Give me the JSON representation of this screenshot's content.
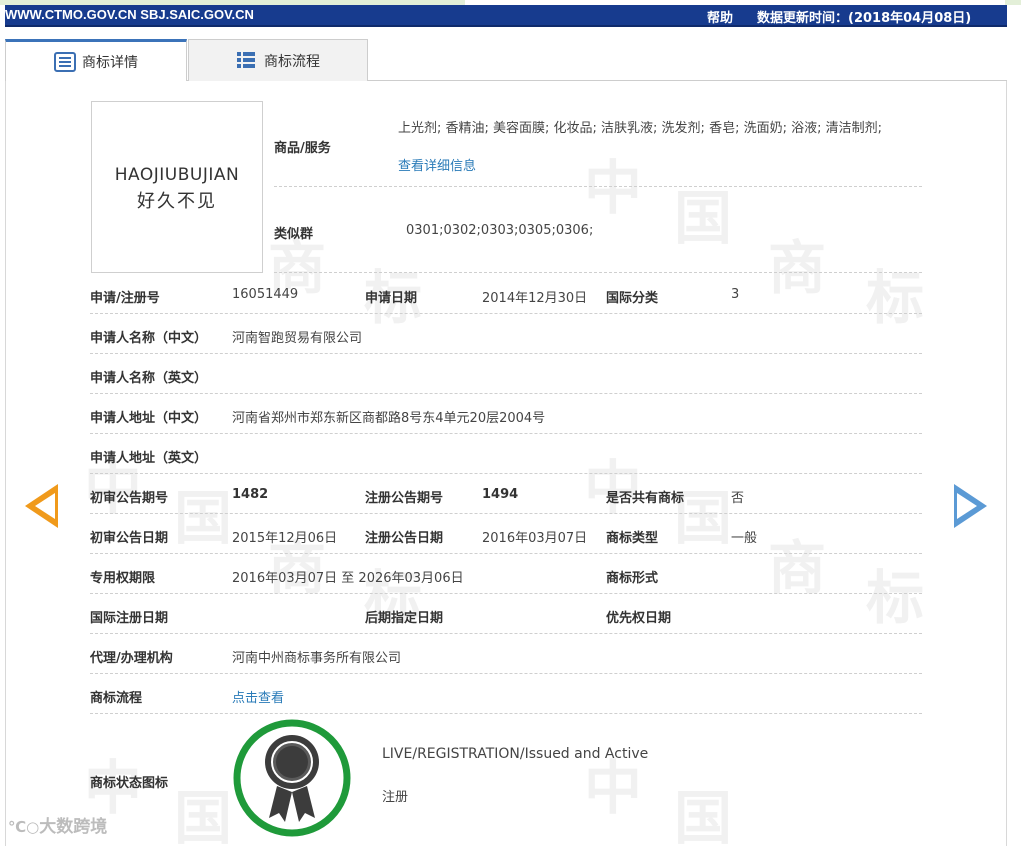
{
  "topbar": {
    "site": "WWW.CTMO.GOV.CN SBJ.SAIC.GOV.CN",
    "help": "帮助",
    "update": "数据更新时间：(2018年04月08日)"
  },
  "tabs": [
    {
      "label": "商标详情",
      "icon": "list-icon"
    },
    {
      "label": "商标流程",
      "icon": "grid-list-icon"
    }
  ],
  "logo": {
    "text_en": "HAOJIUBUJIAN",
    "text_cn": "好久不见"
  },
  "goods": {
    "label": "商品/服务",
    "value": "上光剂; 香精油; 美容面膜; 化妆品; 洁肤乳液; 洗发剂; 香皂; 洗面奶; 浴液; 清洁制剂;",
    "detail_link": "查看详细信息"
  },
  "similar": {
    "label": "类似群",
    "value": "0301;0302;0303;0305;0306;"
  },
  "fields": {
    "reg_no": {
      "label": "申请/注册号",
      "value": "16051449"
    },
    "apply_date": {
      "label": "申请日期",
      "value": "2014年12月30日"
    },
    "intl_class": {
      "label": "国际分类",
      "value": "3"
    },
    "applicant_cn": {
      "label": "申请人名称（中文）",
      "value": "河南智跑贸易有限公司"
    },
    "applicant_en": {
      "label": "申请人名称（英文）",
      "value": ""
    },
    "address_cn": {
      "label": "申请人地址（中文）",
      "value": "河南省郑州市郑东新区商都路8号东4单元20层2004号"
    },
    "address_en": {
      "label": "申请人地址（英文）",
      "value": ""
    },
    "prelim_no": {
      "label": "初审公告期号",
      "value": "1482"
    },
    "reg_pub_no": {
      "label": "注册公告期号",
      "value": "1494"
    },
    "shared": {
      "label": "是否共有商标",
      "value": "否"
    },
    "prelim_date": {
      "label": "初审公告日期",
      "value": "2015年12月06日"
    },
    "reg_pub_date": {
      "label": "注册公告日期",
      "value": "2016年03月07日"
    },
    "tm_type": {
      "label": "商标类型",
      "value": "一般"
    },
    "exclusive_period": {
      "label": "专用权期限",
      "value": "2016年03月07日 至 2026年03月06日"
    },
    "tm_form": {
      "label": "商标形式",
      "value": ""
    },
    "intl_reg_date": {
      "label": "国际注册日期",
      "value": ""
    },
    "later_date": {
      "label": "后期指定日期",
      "value": ""
    },
    "priority_date": {
      "label": "优先权日期",
      "value": ""
    },
    "agent": {
      "label": "代理/办理机构",
      "value": "河南中州商标事务所有限公司"
    },
    "process": {
      "label": "商标流程",
      "value": "点击查看"
    },
    "status_icon": {
      "label": "商标状态图标",
      "status_en": "LIVE/REGISTRATION/Issued and Active",
      "status_cn": "注册"
    }
  },
  "footer_brand": "大数跨境",
  "colors": {
    "topbar": "#173b8e",
    "accent_tab": "#3b73b9",
    "link": "#2a7bb8",
    "arrow_left": "#f09a1b",
    "arrow_right": "#5b9ad5",
    "badge_ring": "#1f9a3a"
  }
}
